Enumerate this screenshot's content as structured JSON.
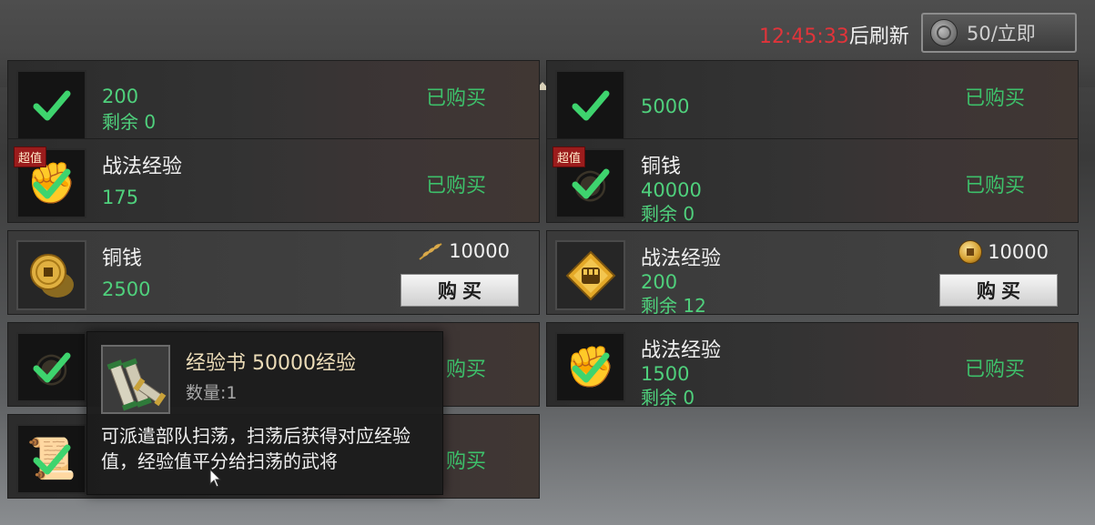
{
  "header": {
    "refresh_time": "12:45:33",
    "refresh_suffix": "后刷新",
    "refresh_cost": "50/立即",
    "refresh_icon": "silver-coin-icon"
  },
  "colors": {
    "bought_green": "#3dc06a",
    "amount_green": "#4fd07c",
    "timer_red": "#e0343a",
    "badge_red": "#9b1c1c"
  },
  "cards": [
    {
      "name": "",
      "amount": "200",
      "remaining": "剩余 0",
      "status": "已购买",
      "badge": "",
      "icon": "check-icon"
    },
    {
      "name": "",
      "amount": "5000",
      "remaining": "",
      "status": "已购买",
      "badge": "",
      "icon": "check-icon"
    },
    {
      "name": "战法经验",
      "amount": "175",
      "remaining": "",
      "status": "已购买",
      "badge": "超值",
      "icon": "check-icon"
    },
    {
      "name": "铜钱",
      "amount": "40000",
      "remaining": "剩余 0",
      "status": "已购买",
      "badge": "超值",
      "icon": "check-icon"
    },
    {
      "name": "铜钱",
      "amount": "2500",
      "remaining": "",
      "price": "10000",
      "price_icon": "grain-icon",
      "buy_label": "购买",
      "icon": "copper-coin-icon"
    },
    {
      "name": "战法经验",
      "amount": "200",
      "remaining": "剩余 12",
      "price": "10000",
      "price_icon": "gold-coin-icon",
      "buy_label": "购买",
      "icon": "fist-emblem-icon"
    },
    {
      "name": "",
      "amount": "",
      "remaining": "",
      "status": "购买",
      "badge": "",
      "icon": "check-icon"
    },
    {
      "name": "战法经验",
      "amount": "1500",
      "remaining": "剩余 0",
      "status": "已购买",
      "badge": "",
      "icon": "check-icon"
    },
    {
      "name": "",
      "amount": "",
      "remaining": "",
      "status": "购买",
      "badge": "",
      "icon": "check-icon"
    }
  ],
  "tooltip": {
    "title": "经验书 50000经验",
    "quantity": "数量:1",
    "description": "可派遣部队扫荡，扫荡后获得对应经验值，经验值平分给扫荡的武将",
    "icon": "scroll-book-icon"
  }
}
